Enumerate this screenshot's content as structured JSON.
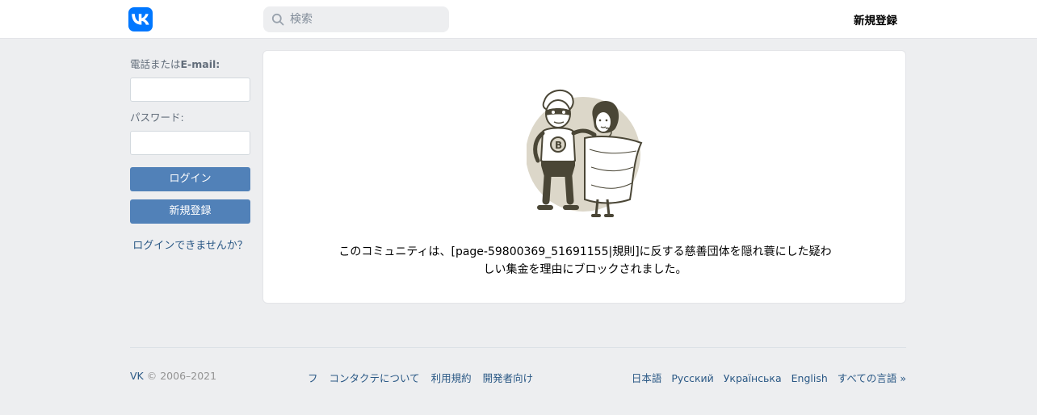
{
  "header": {
    "logo_icon": "vk-logo-icon",
    "search_icon": "search-icon",
    "search_placeholder": "検索",
    "signup_link": "新規登録"
  },
  "login": {
    "phone_label_prefix": "電話または",
    "phone_label_bold": "E-mail:",
    "password_label": "パスワード:",
    "login_button": "ログイン",
    "signup_button": "新規登録",
    "forgot_link": "ログインできませんか？"
  },
  "main": {
    "illustration": "superhero-couple-illustration",
    "message": "このコミュニティは、[page-59800369_51691155|規則]に反する慈善団体を隠れ蓑にした疑わしい集金を理由にブロックされました。"
  },
  "footer": {
    "brand": "VK",
    "copyright": "© 2006–2021",
    "links": [
      "フ",
      "コンタクテについて",
      "利用規約",
      "開発者向け"
    ],
    "languages": [
      "日本語",
      "Русский",
      "Українська",
      "English",
      "すべての言語 »"
    ]
  },
  "colors": {
    "brand": "#0077ff",
    "button": "#5181b8",
    "link": "#2a5885",
    "background": "#edeef0"
  }
}
